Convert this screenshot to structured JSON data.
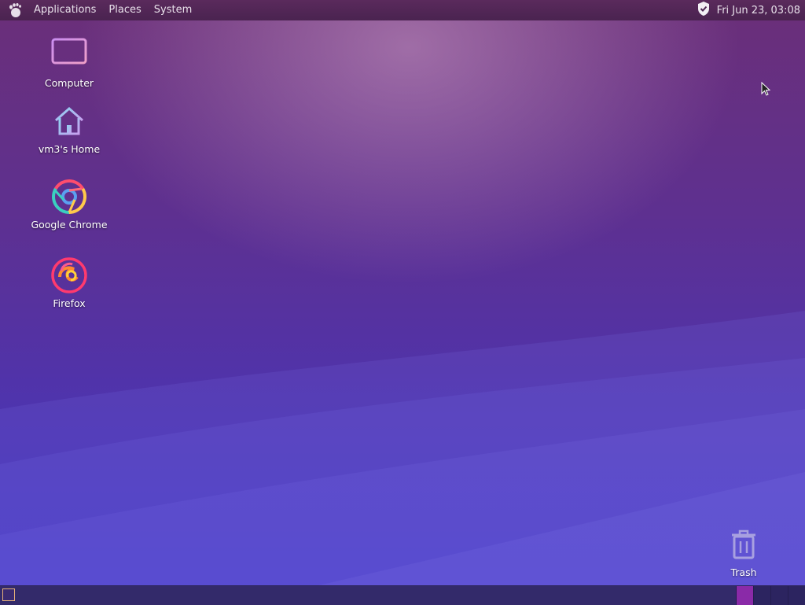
{
  "top_panel": {
    "menus": [
      "Applications",
      "Places",
      "System"
    ],
    "clock": "Fri Jun 23, 03:08"
  },
  "desktop_icons": {
    "computer": "Computer",
    "home": "vm3's Home",
    "chrome": "Google Chrome",
    "firefox": "Firefox",
    "trash": "Trash"
  },
  "colors": {
    "panel": "#4a2350",
    "bottom_panel": "#332a6a",
    "active_workspace": "#8a2aa8"
  }
}
